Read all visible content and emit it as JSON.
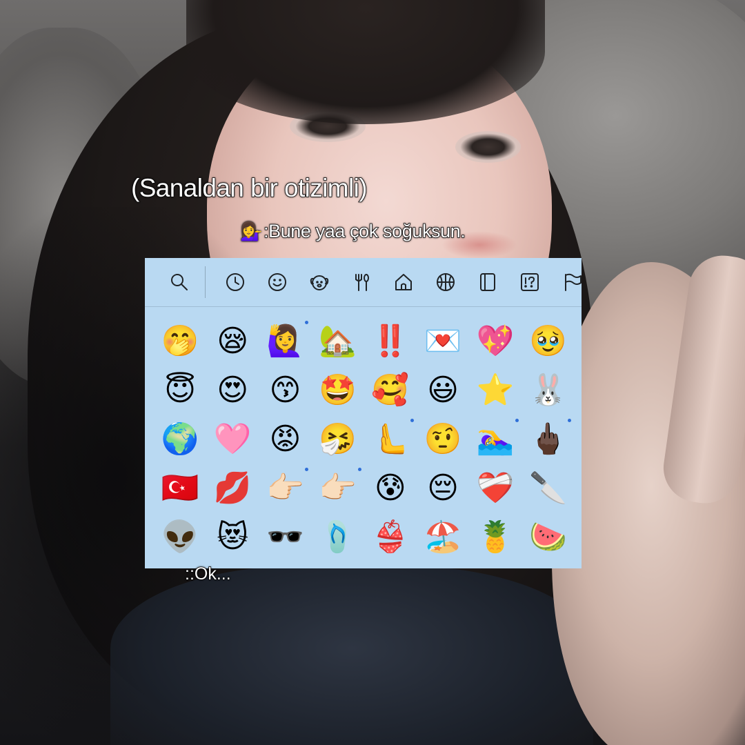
{
  "captions": {
    "title": "(Sanaldan bir otizimli)",
    "line_emoji": "💁‍♀️",
    "line_text": ":Bune yaa çok soğuksun.",
    "reply": "::Ok..."
  },
  "picker": {
    "background": "#b9d9f2",
    "toolbar_icons": [
      "search-icon",
      "recent-clock-icon",
      "smiley-icon",
      "animal-icon",
      "food-utensils-icon",
      "house-icon",
      "basketball-icon",
      "objects-icon",
      "symbols-icon",
      "flag-icon"
    ],
    "rows": [
      [
        "🤭",
        "😪",
        "🙋‍♀️",
        "🏡",
        "‼️",
        "💌",
        "💖",
        "🥹"
      ],
      [
        "😇",
        "😍",
        "😙",
        "🤩",
        "🥰",
        "😃",
        "⭐",
        "🐰"
      ],
      [
        "🌍",
        "🩷",
        "😡",
        "🤧",
        "🫷",
        "🤨",
        "🏊‍♀️",
        "🖕🏿"
      ],
      [
        "🇹🇷",
        "💋",
        "👉🏻",
        "👉🏻",
        "😰",
        "😔",
        "❤️‍🩹",
        "🔪"
      ],
      [
        "👽",
        "😻",
        "🕶️",
        "🩴",
        "👙",
        "🏖️",
        "🍍",
        "🍉"
      ]
    ],
    "variant_dots": [
      [
        0,
        2
      ],
      [
        2,
        4
      ],
      [
        2,
        6
      ],
      [
        2,
        7
      ],
      [
        3,
        2
      ],
      [
        3,
        3
      ]
    ]
  }
}
